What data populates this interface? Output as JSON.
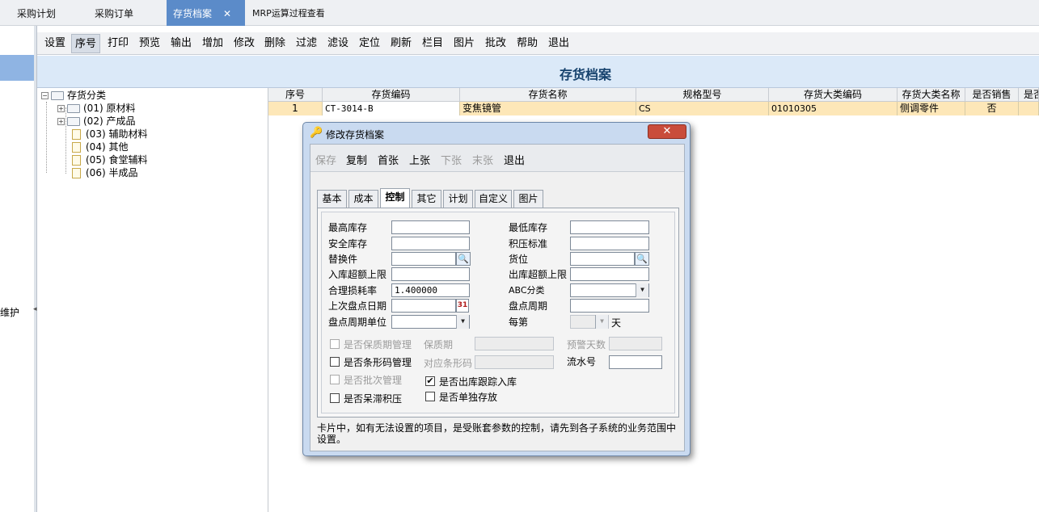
{
  "top_tabs": [
    {
      "label": "采购计划"
    },
    {
      "label": "采购订单"
    },
    {
      "label": "存货档案",
      "close": "✕"
    },
    {
      "label": "MRP运算过程查看"
    }
  ],
  "left_panel": {
    "label": "维护",
    "handle": "◂"
  },
  "toolbar": [
    "设置",
    "序号",
    "打印",
    "预览",
    "输出",
    "增加",
    "修改",
    "删除",
    "过滤",
    "滤设",
    "定位",
    "刷新",
    "栏目",
    "图片",
    "批改",
    "帮助",
    "退出"
  ],
  "banner_title": "存货档案",
  "tree": {
    "root": "存货分类",
    "items": [
      {
        "code": "(01)",
        "name": "原材料",
        "expand": "+"
      },
      {
        "code": "(02)",
        "name": "产成品",
        "expand": "+"
      },
      {
        "code": "(03)",
        "name": "辅助材料"
      },
      {
        "code": "(04)",
        "name": "其他"
      },
      {
        "code": "(05)",
        "name": "食堂辅料"
      },
      {
        "code": "(06)",
        "name": "半成品"
      }
    ],
    "root_expand": "−"
  },
  "grid": {
    "headers": [
      "序号",
      "存货编码",
      "存货名称",
      "规格型号",
      "存货大类编码",
      "存货大类名称",
      "是否销售",
      "是否"
    ],
    "rows": [
      [
        "1",
        "CT-3014-B",
        "变焦镜管",
        "CS",
        "01010305",
        "侧调零件",
        "否",
        ""
      ]
    ]
  },
  "dialog": {
    "title": "修改存货档案",
    "key_icon": "🔑",
    "close": "✕",
    "toolbar": [
      {
        "label": "保存",
        "disabled": true
      },
      {
        "label": "复制",
        "disabled": false
      },
      {
        "label": "首张",
        "disabled": false
      },
      {
        "label": "上张",
        "disabled": false
      },
      {
        "label": "下张",
        "disabled": true
      },
      {
        "label": "末张",
        "disabled": true
      },
      {
        "label": "退出",
        "disabled": false
      }
    ],
    "tabs": [
      "基本",
      "成本",
      "控制",
      "其它",
      "计划",
      "自定义",
      "图片"
    ],
    "active_tab": "控制",
    "fields": {
      "max_stock": "最高库存",
      "min_stock": "最低库存",
      "safety_stock": "安全库存",
      "overstock_std": "积压标准",
      "substitute": "替换件",
      "location": "货位",
      "in_over_limit": "入库超额上限",
      "out_over_limit": "出库超额上限",
      "loss_rate": "合理损耗率",
      "loss_rate_value": "1.400000",
      "abc_class": "ABC分类",
      "last_count_date": "上次盘点日期",
      "count_cycle": "盘点周期",
      "count_cycle_unit": "盘点周期单位",
      "every": "每第",
      "day": "天"
    },
    "checkboxes": {
      "shelf_life_mgmt": "是否保质期管理",
      "shelf_life": "保质期",
      "warn_days": "预警天数",
      "barcode_mgmt": "是否条形码管理",
      "barcode": "对应条形码",
      "serial_no": "流水号",
      "batch_mgmt": "是否批次管理",
      "track_in_out": "是否出库跟踪入库",
      "stagnant": "是否呆滞积压",
      "separate_storage": "是否单独存放",
      "check_mark": "✔"
    },
    "note": "卡片中，如有无法设置的项目，是受账套参数的控制，请先到各子系统的业务范围中设置。",
    "icons": {
      "lookup": "🔍",
      "dropdown": "▼",
      "calendar": "31"
    }
  }
}
